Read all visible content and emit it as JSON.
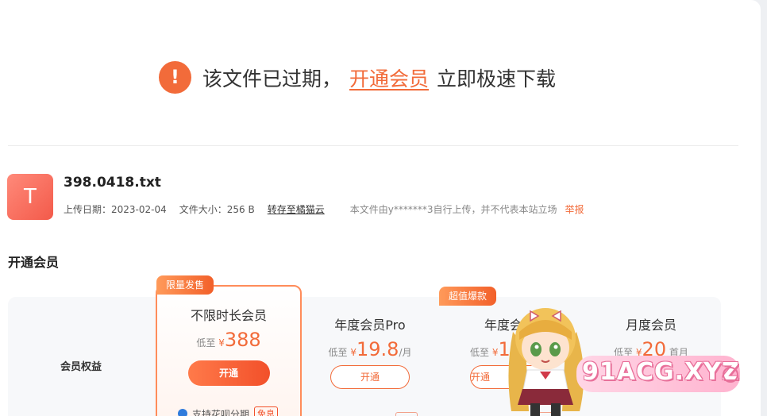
{
  "expired": {
    "icon": "exclamation-icon",
    "icon_glyph": "!",
    "text_before": "该文件已过期，",
    "link": "开通会员",
    "text_after": "立即极速下载"
  },
  "file": {
    "icon_letter": "T",
    "name": "398.0418.txt",
    "upload_date_label": "上传日期：",
    "upload_date": "2023-02-04",
    "size_label": "文件大小：",
    "size": "256 B",
    "transfer": "转存至橘猫云",
    "notice": "本文件由y*******3自行上传，并不代表本站立场",
    "report": "举报"
  },
  "membership": {
    "title": "开通会员",
    "rights_label": "会员权益",
    "limited_badge": "限量发售",
    "value_badge": "超值爆款",
    "plans": [
      {
        "name": "不限时长会员",
        "price_prefix": "低至",
        "currency": "¥",
        "price": "388",
        "unit": "",
        "button": "开通"
      },
      {
        "name": "年度会员Pro",
        "price_prefix": "低至",
        "currency": "¥",
        "price": "19.8",
        "unit": "/月",
        "button": "开通"
      },
      {
        "name": "年度会",
        "price_prefix": "低至",
        "currency": "¥",
        "price": "1",
        "unit": "",
        "button": "开通"
      },
      {
        "name": "月度会员",
        "price_prefix": "低至",
        "currency": "¥",
        "price": "20",
        "unit": "首月",
        "button": ""
      }
    ],
    "huabei_text": "支持花呗分期",
    "huabei_free": "免息"
  },
  "watermark": {
    "text": "91ACG.XYZ"
  },
  "colors": {
    "accent": "#f26b3a",
    "badge": "#f2602a",
    "watermark": "#ffb3cf"
  }
}
